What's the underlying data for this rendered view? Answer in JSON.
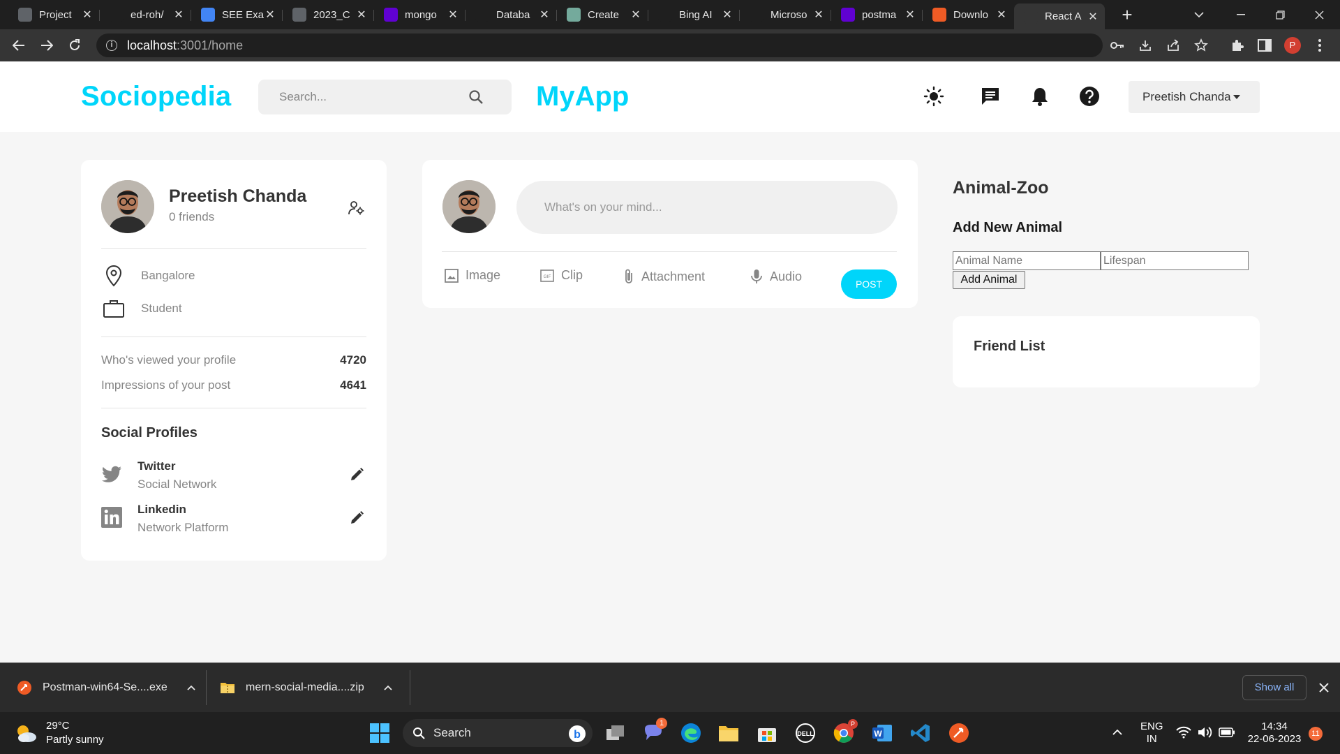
{
  "browser": {
    "tabs": [
      {
        "title": "Project",
        "favicon": "doc-icon",
        "color": "#5f6368"
      },
      {
        "title": "ed-roh/",
        "favicon": "github-icon",
        "color": "#1f1f1f"
      },
      {
        "title": "SEE Exa",
        "favicon": "google-docs-icon",
        "color": "#4285f4"
      },
      {
        "title": "2023_C",
        "favicon": "doc-icon",
        "color": "#5f6368"
      },
      {
        "title": "mongo",
        "favicon": "yahoo-icon",
        "color": "#6001d2"
      },
      {
        "title": "Databa",
        "favicon": "mongodb-leaf-icon",
        "color": "#1f1f1f"
      },
      {
        "title": "Create",
        "favicon": "chatgpt-icon",
        "color": "#74aa9c"
      },
      {
        "title": "Bing AI",
        "favicon": "bing-search-icon",
        "color": "#1f1f1f"
      },
      {
        "title": "Microso",
        "favicon": "globe-icon",
        "color": "#1f1f1f"
      },
      {
        "title": "postma",
        "favicon": "yahoo-icon",
        "color": "#6001d2"
      },
      {
        "title": "Downlo",
        "favicon": "postman-icon",
        "color": "#ef5b25"
      },
      {
        "title": "React A",
        "favicon": "react-icon",
        "color": "#353535"
      }
    ],
    "url_host": "localhost",
    "url_path": ":3001/home",
    "profile_initial": "P"
  },
  "app": {
    "logo": "Sociopedia",
    "search_placeholder": "Search...",
    "myapp": "MyApp",
    "user_select": "Preetish Chanda",
    "accent": "#00d5fa"
  },
  "profile": {
    "name": "Preetish Chanda",
    "friends": "0 friends",
    "location": "Bangalore",
    "occupation": "Student",
    "viewed_label": "Who's viewed your profile",
    "viewed_value": "4720",
    "impressions_label": "Impressions of your post",
    "impressions_value": "4641",
    "social_title": "Social Profiles",
    "socials": [
      {
        "name": "Twitter",
        "sub": "Social Network"
      },
      {
        "name": "Linkedin",
        "sub": "Network Platform"
      }
    ]
  },
  "post": {
    "placeholder": "What's on your mind...",
    "image": "Image",
    "clip": "Clip",
    "attachment": "Attachment",
    "audio": "Audio",
    "post": "POST"
  },
  "zoo": {
    "title": "Animal-Zoo",
    "subtitle": "Add New Animal",
    "name_placeholder": "Animal Name",
    "lifespan_placeholder": "Lifespan",
    "button": "Add Animal"
  },
  "friends": {
    "title": "Friend List"
  },
  "downloads": [
    {
      "name": "Postman-win64-Se....exe"
    },
    {
      "name": "mern-social-media....zip"
    }
  ],
  "downloads_show_all": "Show all",
  "taskbar": {
    "temp": "29°C",
    "weather": "Partly sunny",
    "search": "Search",
    "lang1": "ENG",
    "lang2": "IN",
    "time": "14:34",
    "date": "22-06-2023",
    "notif_count": "11",
    "teams_badge": "1"
  }
}
